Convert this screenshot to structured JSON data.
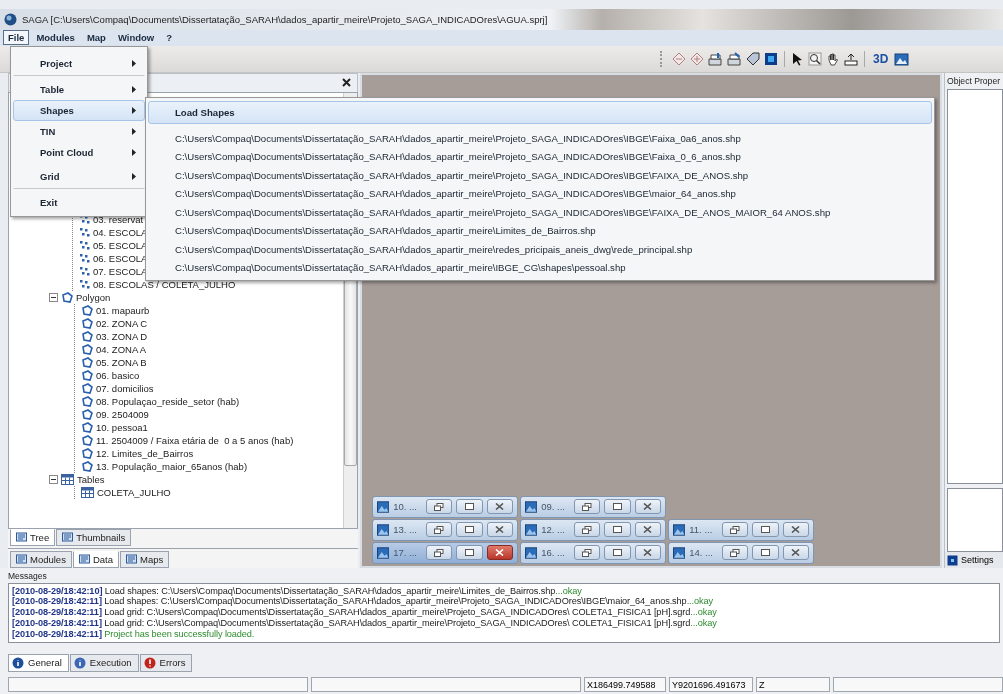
{
  "window": {
    "title": "SAGA [C:\\Users\\Compaq\\Documents\\Dissertatação_SARAH\\dados_apartir_meire\\Projeto_SAGA_INDICADOres\\AGUA.sprj]"
  },
  "menubar": [
    {
      "label": "File",
      "selected": true
    },
    {
      "label": "Modules",
      "selected": false
    },
    {
      "label": "Map",
      "selected": false
    },
    {
      "label": "Window",
      "selected": false
    },
    {
      "label": "?",
      "selected": false
    }
  ],
  "file_menu": {
    "items": [
      {
        "label": "Project",
        "submenu": true,
        "selected": false,
        "separator_after": true
      },
      {
        "label": "Table",
        "submenu": true,
        "selected": false,
        "separator_after": false
      },
      {
        "label": "Shapes",
        "submenu": true,
        "selected": true,
        "separator_after": false
      },
      {
        "label": "TIN",
        "submenu": true,
        "selected": false,
        "separator_after": false
      },
      {
        "label": "Point Cloud",
        "submenu": true,
        "selected": false,
        "separator_after": false
      },
      {
        "label": "Grid",
        "submenu": true,
        "selected": false,
        "separator_after": true
      },
      {
        "label": "Exit",
        "submenu": false,
        "selected": false,
        "separator_after": false
      }
    ]
  },
  "shapes_submenu": {
    "items": [
      {
        "label": "Load Shapes",
        "selected": true
      },
      {
        "label": "C:\\Users\\Compaq\\Documents\\Dissertatação_SARAH\\dados_apartir_meire\\Projeto_SAGA_INDICADOres\\IBGE\\Faixa_0a6_anos.shp",
        "selected": false
      },
      {
        "label": "C:\\Users\\Compaq\\Documents\\Dissertatação_SARAH\\dados_apartir_meire\\Projeto_SAGA_INDICADOres\\IBGE\\Faixa_0_6_anos.shp",
        "selected": false
      },
      {
        "label": "C:\\Users\\Compaq\\Documents\\Dissertatação_SARAH\\dados_apartir_meire\\Projeto_SAGA_INDICADOres\\IBGE\\FAIXA_DE_ANOS.shp",
        "selected": false
      },
      {
        "label": "C:\\Users\\Compaq\\Documents\\Dissertatação_SARAH\\dados_apartir_meire\\Projeto_SAGA_INDICADOres\\IBGE\\maior_64_anos.shp",
        "selected": false
      },
      {
        "label": "C:\\Users\\Compaq\\Documents\\Dissertatação_SARAH\\dados_apartir_meire\\Projeto_SAGA_INDICADOres\\IBGE\\FAIXA_DE_ANOS_MAIOR_64 ANOS.shp",
        "selected": false
      },
      {
        "label": "C:\\Users\\Compaq\\Documents\\Dissertatação_SARAH\\dados_apartir_meire\\Limites_de_Bairros.shp",
        "selected": false
      },
      {
        "label": "C:\\Users\\Compaq\\Documents\\Dissertatação_SARAH\\dados_apartir_meire\\redes_pricipais_aneis_dwg\\rede_principal.shp",
        "selected": false
      },
      {
        "label": "C:\\Users\\Compaq\\Documents\\Dissertatação_SARAH\\dados_apartir_meire\\IBGE_CG\\shapes\\pessoal.shp",
        "selected": false
      }
    ]
  },
  "toolbar": {
    "label_3d": "3D"
  },
  "workspace": {
    "tree": [
      {
        "kind": "points",
        "expanded": true,
        "children": [
          {
            "label": "03. reservat"
          },
          {
            "label": "04. ESCOLA"
          },
          {
            "label": "05. ESCOLA"
          },
          {
            "label": "06. ESCOLA"
          },
          {
            "label": "07. ESCOLA"
          },
          {
            "label": "08. ESCOLAS / COLETA_JULHO"
          }
        ]
      },
      {
        "kind": "polygon",
        "label": "Polygon",
        "expanded": true,
        "children": [
          {
            "label": "01. mapaurb"
          },
          {
            "label": "02. ZONA C"
          },
          {
            "label": "03. ZONA D"
          },
          {
            "label": "04. ZONA A"
          },
          {
            "label": "05. ZONA B"
          },
          {
            "label": "06. basico"
          },
          {
            "label": "07. domicilios"
          },
          {
            "label": "08. Populaçao_reside_setor (hab)"
          },
          {
            "label": "09. 2504009"
          },
          {
            "label": "10. pessoa1"
          },
          {
            "label": "11. 2504009 / Faixa etária de  0 a 5 anos (hab)"
          },
          {
            "label": "12. Limites_de_Bairros"
          },
          {
            "label": "13. População_maior_65anos (hab)"
          }
        ]
      },
      {
        "kind": "table",
        "label": "Tables",
        "expanded": true,
        "children": [
          {
            "label": "COLETA_JULHO"
          }
        ]
      }
    ],
    "view_tabs": [
      {
        "label": "Tree",
        "selected": true
      },
      {
        "label": "Thumbnails",
        "selected": false
      }
    ],
    "manager_tabs": [
      {
        "label": "Modules",
        "selected": false
      },
      {
        "label": "Data",
        "selected": true
      },
      {
        "label": "Maps",
        "selected": false
      }
    ]
  },
  "mdi": {
    "rows": [
      {
        "windows": [
          {
            "label": "10. ...",
            "active": false
          },
          {
            "label": "09. ...",
            "active": false
          }
        ]
      },
      {
        "windows": [
          {
            "label": "13. ...",
            "active": false
          },
          {
            "label": "12. ...",
            "active": false
          },
          {
            "label": "11. ...",
            "active": false
          }
        ]
      },
      {
        "windows": [
          {
            "label": "17. ...",
            "active": true
          },
          {
            "label": "16. ...",
            "active": false
          },
          {
            "label": "14. ...",
            "active": false
          }
        ]
      }
    ]
  },
  "properties": {
    "title": "Object Proper",
    "tab": "Settings"
  },
  "messages": {
    "title": "Messages",
    "lines": [
      {
        "time": "[2010-08-29/18:42:10]",
        "text": "Load shapes: C:\\Users\\Compaq\\Documents\\Dissertatação_SARAH\\dados_apartir_meire\\Limites_de_Bairros.shp",
        "result": "...okay"
      },
      {
        "time": "[2010-08-29/18:42:11]",
        "text": "Load shapes: C:\\Users\\Compaq\\Documents\\Dissertatação_SARAH\\dados_apartir_meire\\Projeto_SAGA_INDICADOres\\IBGE\\maior_64_anos.shp",
        "result": "...okay"
      },
      {
        "time": "[2010-08-29/18:42:11]",
        "text": "Load grid: C:\\Users\\Compaq\\Documents\\Dissertatação_SARAH\\dados_apartir_meire\\Projeto_SAGA_INDICADOres\\ COLETA1_FISICA1 [pH].sgrd",
        "result": "...okay"
      },
      {
        "time": "[2010-08-29/18:42:11]",
        "text": "Load grid: C:\\Users\\Compaq\\Documents\\Dissertatação_SARAH\\dados_apartir_meire\\Projeto_SAGA_INDICADOres\\ COLETA1_FISICA1 [pH].sgrd",
        "result": "...okay"
      },
      {
        "time": "[2010-08-29/18:42:11]",
        "result": "Project has been successfully loaded."
      }
    ],
    "tabs": [
      {
        "label": "General",
        "kind": "info",
        "selected": true
      },
      {
        "label": "Execution",
        "kind": "execution",
        "selected": false
      },
      {
        "label": "Errors",
        "kind": "error",
        "selected": false
      }
    ]
  },
  "status_bar": {
    "x": "X186499.749588",
    "y": "Y9201696.491673",
    "z": "Z"
  }
}
